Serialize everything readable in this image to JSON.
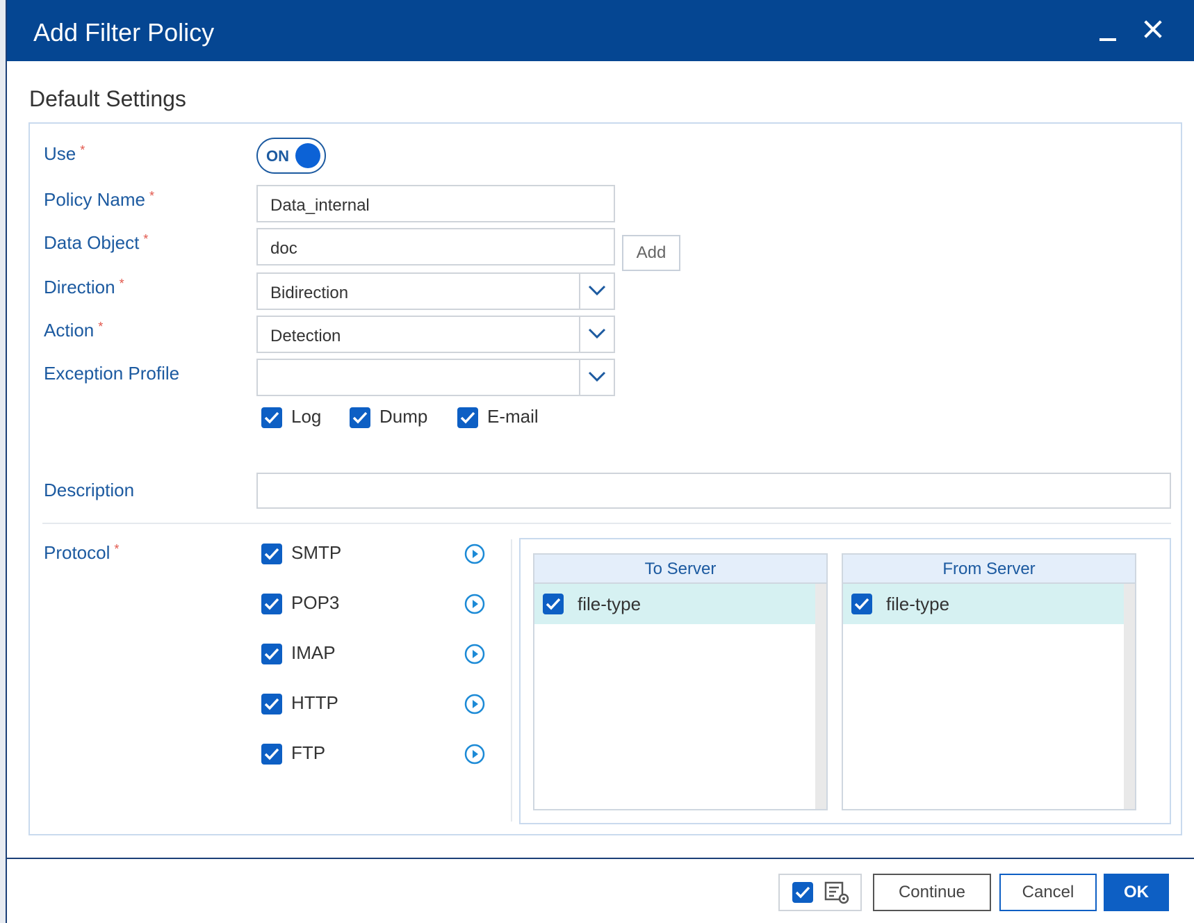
{
  "window": {
    "title": "Add Filter Policy"
  },
  "section": {
    "title": "Default Settings"
  },
  "form": {
    "use": {
      "label": "Use",
      "required": "*",
      "toggle_text": "ON"
    },
    "policy_name": {
      "label": "Policy Name",
      "required": "*",
      "value": "Data_internal"
    },
    "data_object": {
      "label": "Data Object",
      "required": "*",
      "value": "doc",
      "add_label": "Add"
    },
    "direction": {
      "label": "Direction",
      "required": "*",
      "value": "Bidirection"
    },
    "action": {
      "label": "Action",
      "required": "*",
      "value": "Detection"
    },
    "exception_profile": {
      "label": "Exception Profile",
      "value": ""
    },
    "options": [
      {
        "label": "Log",
        "checked": true
      },
      {
        "label": "Dump",
        "checked": true
      },
      {
        "label": "E-mail",
        "checked": true
      }
    ],
    "description": {
      "label": "Description",
      "value": ""
    },
    "protocol": {
      "label": "Protocol",
      "required": "*",
      "items": [
        {
          "label": "SMTP",
          "checked": true
        },
        {
          "label": "POP3",
          "checked": true
        },
        {
          "label": "IMAP",
          "checked": true
        },
        {
          "label": "HTTP",
          "checked": true
        },
        {
          "label": "FTP",
          "checked": true
        }
      ]
    }
  },
  "lists": {
    "to_server": {
      "header": "To Server",
      "items": [
        {
          "label": "file-type",
          "checked": true
        }
      ]
    },
    "from_server": {
      "header": "From Server",
      "items": [
        {
          "label": "file-type",
          "checked": true
        }
      ]
    }
  },
  "footer": {
    "continue_label": "Continue",
    "cancel_label": "Cancel",
    "ok_label": "OK"
  },
  "icons": {
    "minimize": "minimize-icon",
    "close": "close-icon",
    "dropdown": "chevron-down-icon",
    "checkbox": "checkmark-icon",
    "protocol_go": "circle-arrow-right-icon",
    "settings": "list-gear-icon"
  },
  "colors": {
    "titlebar": "#054692",
    "label": "#1c5aa0",
    "accent": "#0d5fc4",
    "row_highlight": "#d6f1f2"
  }
}
